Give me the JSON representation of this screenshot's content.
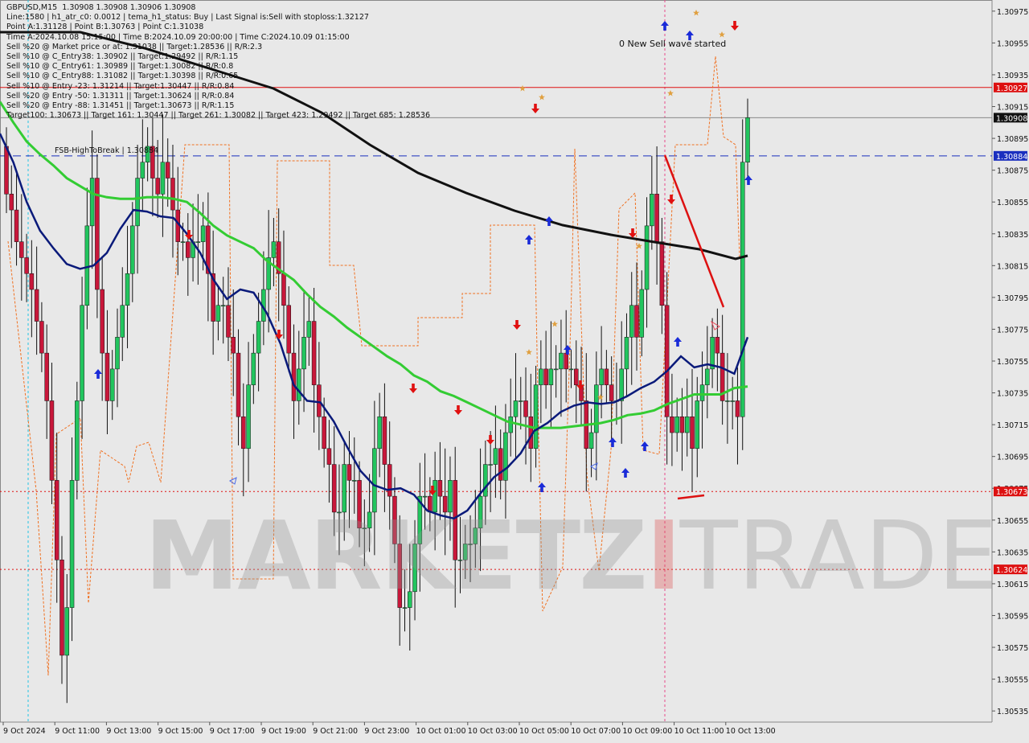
{
  "header": {
    "lines": [
      "GBPUSD,M15  1.30908 1.30908 1.30906 1.30908",
      "Line:1580 | h1_atr_c0: 0.0012 | tema_h1_status: Buy | Last Signal is:Sell with stoploss:1.32127",
      "Point A:1.31128 | Point B:1.30763 | Point C:1.31038",
      "Time A:2024.10.08 15:15:00 | Time B:2024.10.09 20:00:00 | Time C:2024.10.09 01:15:00",
      "Sell %20 @ Market price or at: 1.31038 || Target:1.28536 || R/R:2.3",
      "Sell %10 @ C_Entry38: 1.30902 || Target:1.29492 || R/R:1.15",
      "Sell %10 @ C_Entry61: 1.30989 || Target:1.30082 || R/R:0.8",
      "Sell %10 @ C_Entry88: 1.31082 || Target:1.30398 || R/R:0.65",
      "Sell %10 @ Entry -23: 1.31214 || Target:1.30447 || R/R:0.84",
      "Sell %20 @ Entry -50: 1.31311 || Target:1.30624 || R/R:0.84",
      "Sell %20 @ Entry -88: 1.31451 || Target:1.30673 || R/R:1.15",
      "Target100: 1.30673 || Target 161: 1.30447 || Target 261: 1.30082 || Target 423: 1.29492 || Target 685: 1.28536"
    ]
  },
  "annotations": {
    "wave_note": "0 New Sell wave started",
    "fsb_label": "FSB-HighToBreak | 1.30884"
  },
  "watermark": {
    "part1": "MARKETZ",
    "part2": "I",
    "part3": "TRADE"
  },
  "colors": {
    "background": "#e8e8e8",
    "bull": "#22c55e",
    "bear": "#c8173a",
    "sma_green": "#33cc33",
    "ma_navy": "#0a1a7a",
    "ma_black": "#111111",
    "orange_line": "#f07020",
    "red_level": "#dd1111",
    "blue_level": "#1a2fbf"
  },
  "chart_data": {
    "type": "candlestick",
    "symbol": "GBPUSD",
    "timeframe": "M15",
    "ylim": [
      1.30528,
      1.30982
    ],
    "price_ticks": [
      "1.30975",
      "1.30955",
      "1.30935",
      "1.30915",
      "1.30895",
      "1.30875",
      "1.30855",
      "1.30835",
      "1.30815",
      "1.30795",
      "1.30775",
      "1.30755",
      "1.30735",
      "1.30715",
      "1.30695",
      "1.30675",
      "1.30655",
      "1.30635",
      "1.30615",
      "1.30595",
      "1.30575",
      "1.30555",
      "1.30535"
    ],
    "time_labels": [
      "9 Oct 2024",
      "9 Oct 11:00",
      "9 Oct 13:00",
      "9 Oct 15:00",
      "9 Oct 17:00",
      "9 Oct 19:00",
      "9 Oct 21:00",
      "9 Oct 23:00",
      "10 Oct 01:00",
      "10 Oct 03:00",
      "10 Oct 05:00",
      "10 Oct 07:00",
      "10 Oct 09:00",
      "10 Oct 11:00",
      "10 Oct 13:00"
    ],
    "levels": [
      {
        "label": "1.30927",
        "value": 1.30927,
        "kind": "red_solid"
      },
      {
        "label": "1.30908",
        "value": 1.30908,
        "kind": "current"
      },
      {
        "label": "1.30884",
        "value": 1.30884,
        "kind": "blue_dashed"
      },
      {
        "label": "1.30673",
        "value": 1.30673,
        "kind": "red_dotted"
      },
      {
        "label": "1.30624",
        "value": 1.30624,
        "kind": "red_dotted"
      }
    ],
    "closes": [
      1.3086,
      1.3085,
      1.3083,
      1.3082,
      1.3081,
      1.308,
      1.3078,
      1.3076,
      1.3073,
      1.3068,
      1.3063,
      1.3057,
      1.306,
      1.3068,
      1.3073,
      1.3079,
      1.3084,
      1.3087,
      1.308,
      1.3076,
      1.3073,
      1.3075,
      1.3077,
      1.3079,
      1.3081,
      1.3084,
      1.3087,
      1.3088,
      1.3089,
      1.3087,
      1.3086,
      1.3088,
      1.3087,
      1.3085,
      1.3083,
      1.3083,
      1.3082,
      1.3083,
      1.3083,
      1.3084,
      1.3081,
      1.3078,
      1.3079,
      1.3079,
      1.3077,
      1.3076,
      1.3072,
      1.307,
      1.3074,
      1.3076,
      1.3078,
      1.308,
      1.3082,
      1.3083,
      1.3081,
      1.3079,
      1.3076,
      1.3073,
      1.3075,
      1.3077,
      1.3078,
      1.3074,
      1.3072,
      1.307,
      1.3069,
      1.3066,
      1.3066,
      1.3069,
      1.3068,
      1.3068,
      1.3065,
      1.3065,
      1.3066,
      1.307,
      1.3072,
      1.3069,
      1.3067,
      1.3064,
      1.306,
      1.306,
      1.3061,
      1.3064,
      1.3067,
      1.3067,
      1.3066,
      1.3068,
      1.3067,
      1.3066,
      1.3068,
      1.3063,
      1.3063,
      1.3064,
      1.3064,
      1.3065,
      1.3067,
      1.3069,
      1.3069,
      1.307,
      1.3068,
      1.3071,
      1.3072,
      1.3073,
      1.3073,
      1.3072,
      1.307,
      1.3074,
      1.3075,
      1.3074,
      1.3075,
      1.3075,
      1.3076,
      1.3075,
      1.3075,
      1.3074,
      1.3073,
      1.307,
      1.3071,
      1.3074,
      1.3075,
      1.3074,
      1.3073,
      1.3073,
      1.3075,
      1.3077,
      1.3079,
      1.3077,
      1.308,
      1.3084,
      1.3086,
      1.3083,
      1.3079,
      1.3072,
      1.3071,
      1.3072,
      1.3071,
      1.3072,
      1.307,
      1.3073,
      1.3074,
      1.3075,
      1.3077,
      1.3076,
      1.3073,
      1.3073,
      1.3073,
      1.3072,
      1.3088,
      1.30908
    ],
    "sma_green": [
      1.30918,
      1.30905,
      1.30893,
      1.30885,
      1.30878,
      1.3087,
      1.30865,
      1.3086,
      1.30858,
      1.30857,
      1.30857,
      1.30858,
      1.30858,
      1.30857,
      1.30855,
      1.30848,
      1.3084,
      1.30834,
      1.3083,
      1.30826,
      1.30818,
      1.30812,
      1.30806,
      1.30797,
      1.30789,
      1.30783,
      1.30776,
      1.3077,
      1.30764,
      1.30758,
      1.30753,
      1.30746,
      1.30742,
      1.30736,
      1.30733,
      1.30729,
      1.30725,
      1.30721,
      1.30717,
      1.30715,
      1.30713,
      1.30713,
      1.30713,
      1.30714,
      1.30715,
      1.30716,
      1.30718,
      1.30721,
      1.30722,
      1.30724,
      1.30728,
      1.30731,
      1.30734,
      1.30734,
      1.30734,
      1.30738,
      1.30739
    ],
    "ma_navy": [
      1.30898,
      1.3088,
      1.30855,
      1.30837,
      1.30826,
      1.30816,
      1.30813,
      1.30815,
      1.30823,
      1.30838,
      1.3085,
      1.30849,
      1.30846,
      1.30845,
      1.30835,
      1.30823,
      1.30806,
      1.30794,
      1.308,
      1.30798,
      1.30785,
      1.30766,
      1.3074,
      1.3073,
      1.30729,
      1.30717,
      1.30701,
      1.30686,
      1.30677,
      1.30674,
      1.30675,
      1.30671,
      1.30661,
      1.30658,
      1.30656,
      1.30661,
      1.30672,
      1.30682,
      1.30688,
      1.30697,
      1.30711,
      1.30716,
      1.30723,
      1.30727,
      1.30729,
      1.30728,
      1.30729,
      1.30733,
      1.30738,
      1.30742,
      1.30749,
      1.30758,
      1.30751,
      1.30753,
      1.30751,
      1.30747,
      1.3077
    ]
  }
}
